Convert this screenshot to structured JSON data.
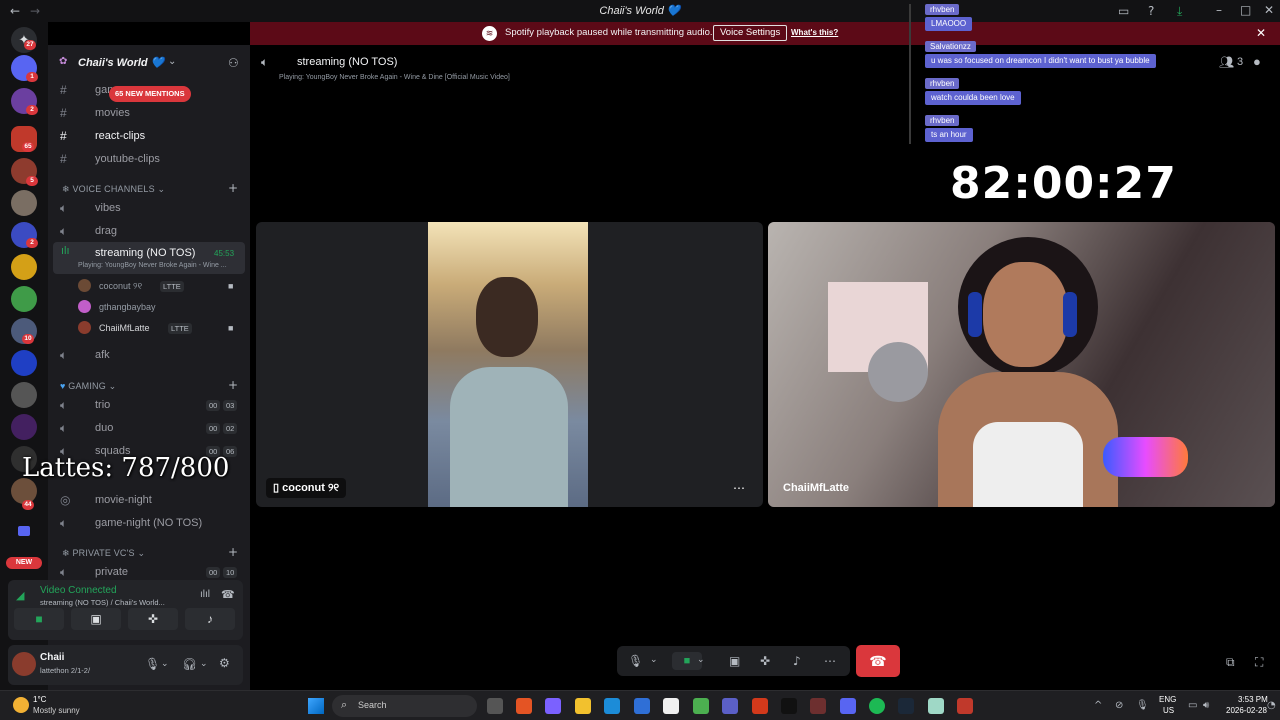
{
  "window": {
    "title": "Chaii's World 💙"
  },
  "notice": {
    "message": "Spotify playback paused while transmitting audio.",
    "button": "Voice Settings",
    "link": "What's this?"
  },
  "rail": {
    "badges": [
      "27",
      "1",
      "2",
      "65",
      "5",
      "2",
      "10",
      "44"
    ],
    "new_label": "NEW"
  },
  "guild": {
    "name": "Chaii's World 💙",
    "mentions_pill": "65 NEW MENTIONS"
  },
  "channels": {
    "text": [
      {
        "name": "gam"
      },
      {
        "name": "movies"
      },
      {
        "name": "react-clips"
      },
      {
        "name": "youtube-clips"
      }
    ],
    "voice_category": "VOICE CHANNELS",
    "voice": [
      {
        "name": "vibes"
      },
      {
        "name": "drag"
      }
    ],
    "active": {
      "name": "streaming (NO TOS)",
      "time": "45:53",
      "activity": "Playing: YoungBoy Never Broke Again - Wine ..."
    },
    "members": [
      {
        "name": "coconut ୨୧",
        "tag": "LTTE"
      },
      {
        "name": "gthangbaybay",
        "tag": ""
      },
      {
        "name": "ChaiiMfLatte",
        "tag": "LTTE"
      }
    ],
    "afk": "afk",
    "gaming_category": "GAMING",
    "gaming": [
      {
        "name": "trio",
        "c1": "00",
        "c2": "03"
      },
      {
        "name": "duo",
        "c1": "00",
        "c2": "02"
      },
      {
        "name": "squads",
        "c1": "00",
        "c2": "06"
      }
    ],
    "events": [
      {
        "name": "movie-night"
      },
      {
        "name": "game-night (NO TOS)"
      }
    ],
    "private_category": "PRIVATE VC'S",
    "private": [
      {
        "name": "private",
        "c1": "00",
        "c2": "10"
      }
    ]
  },
  "overlay": {
    "lattes": "Lattes: 787/800",
    "timer": "82:00:27"
  },
  "voice_status": {
    "title": "Video Connected",
    "sub": "streaming (NO TOS) / Chaii's World..."
  },
  "user": {
    "name": "Chaii",
    "status": "lattethon 2/1-2/"
  },
  "stage": {
    "channel": "streaming (NO TOS)",
    "activity": "Playing: YoungBoy Never Broke Again - Wine & Dine [Official Music Video]",
    "participants_count": "3",
    "tiles": [
      {
        "name": "coconut ୨୧"
      },
      {
        "name": "ChaiiMfLatte"
      }
    ]
  },
  "chat": [
    {
      "user": "rhvben",
      "msg": "LMAOOO"
    },
    {
      "user": "Salvationzz",
      "msg": "u was so focused on dreamcon I didn't want to bust ya bubble"
    },
    {
      "user": "rhvben",
      "msg": "watch coulda been love"
    },
    {
      "user": "rhvben",
      "msg": "ts an hour"
    }
  ],
  "taskbar": {
    "weather_temp": "1°C",
    "weather_text": "Mostly sunny",
    "search": "Search",
    "lang1": "ENG",
    "lang2": "US",
    "time": "3:53 PM",
    "date": "2026-02-28"
  }
}
